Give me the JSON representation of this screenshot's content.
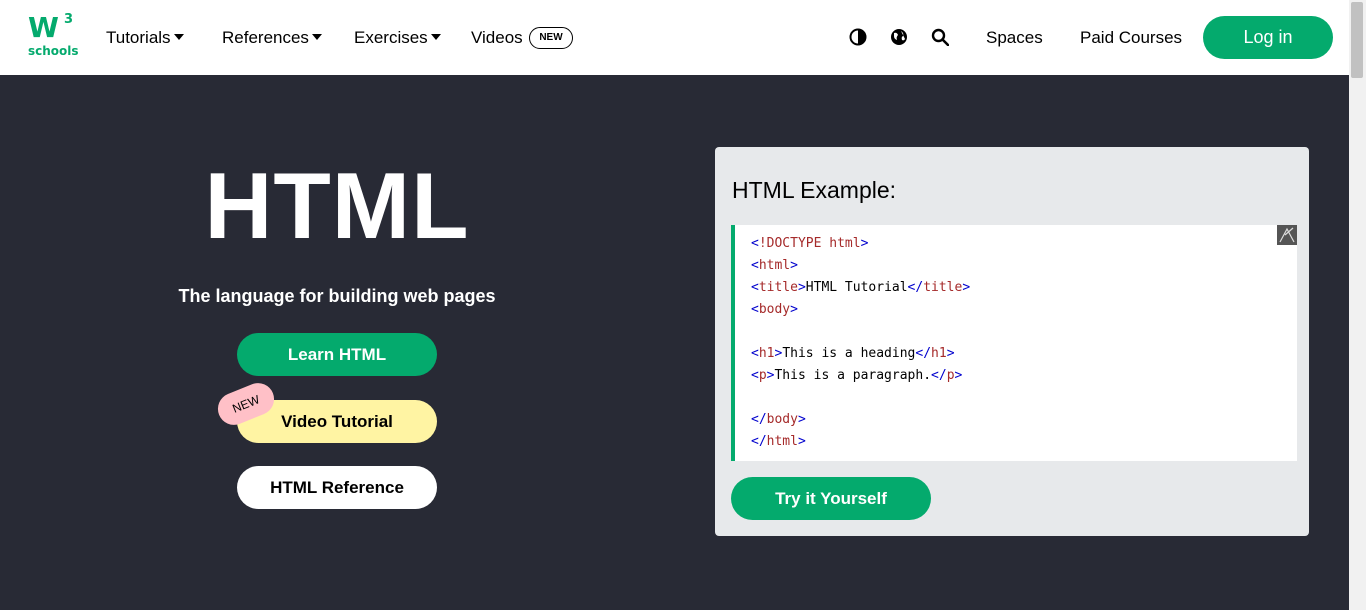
{
  "logo": {
    "w": "W",
    "sup": "3",
    "text": "schools"
  },
  "nav": {
    "tutorials": "Tutorials",
    "references": "References",
    "exercises": "Exercises",
    "videos": "Videos",
    "new_badge": "NEW",
    "spaces": "Spaces",
    "paid_courses": "Paid Courses",
    "login": "Log in",
    "icons": [
      "contrast-icon",
      "globe-icon",
      "search-icon"
    ]
  },
  "hero": {
    "title": "HTML",
    "subtitle": "The language for building web pages",
    "learn_button": "Learn HTML",
    "video_button": "Video Tutorial",
    "video_new": "NEW",
    "reference_button": "HTML Reference"
  },
  "example": {
    "title": "HTML Example:",
    "lines": [
      {
        "open": "<",
        "name": "!DOCTYPE",
        "attr": " html",
        "close": ">",
        "text": "",
        "end_open": "",
        "end_name": "",
        "end_close": ""
      },
      {
        "open": "<",
        "name": "html",
        "attr": "",
        "close": ">",
        "text": "",
        "end_open": "",
        "end_name": "",
        "end_close": ""
      },
      {
        "open": "<",
        "name": "title",
        "attr": "",
        "close": ">",
        "text": "HTML Tutorial",
        "end_open": "</",
        "end_name": "title",
        "end_close": ">"
      },
      {
        "open": "<",
        "name": "body",
        "attr": "",
        "close": ">",
        "text": "",
        "end_open": "",
        "end_name": "",
        "end_close": ""
      },
      {
        "open": "",
        "name": "",
        "attr": "",
        "close": "",
        "text": "",
        "end_open": "",
        "end_name": "",
        "end_close": ""
      },
      {
        "open": "<",
        "name": "h1",
        "attr": "",
        "close": ">",
        "text": "This is a heading",
        "end_open": "</",
        "end_name": "h1",
        "end_close": ">"
      },
      {
        "open": "<",
        "name": "p",
        "attr": "",
        "close": ">",
        "text": "This is a paragraph.",
        "end_open": "</",
        "end_name": "p",
        "end_close": ">"
      },
      {
        "open": "",
        "name": "",
        "attr": "",
        "close": "",
        "text": "",
        "end_open": "",
        "end_name": "",
        "end_close": ""
      },
      {
        "open": "</",
        "name": "body",
        "attr": "",
        "close": ">",
        "text": "",
        "end_open": "",
        "end_name": "",
        "end_close": ""
      },
      {
        "open": "</",
        "name": "html",
        "attr": "",
        "close": ">",
        "text": "",
        "end_open": "",
        "end_name": "",
        "end_close": ""
      }
    ],
    "try_button": "Try it Yourself"
  },
  "colors": {
    "accent": "#04AA6D",
    "dark_bg": "#282A35",
    "example_bg": "#E7E9EB",
    "video_btn": "#FFF4A3",
    "new_sticker": "#FFC0C7"
  }
}
